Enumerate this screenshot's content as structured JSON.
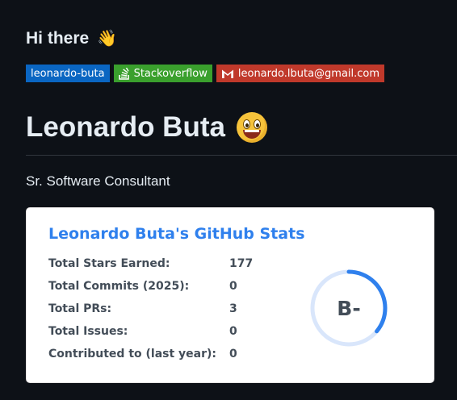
{
  "greeting": {
    "text": "Hi there",
    "emoji": "👋"
  },
  "badges": [
    {
      "label": "leonardo-buta",
      "color": "#0a66c2",
      "icon": "none"
    },
    {
      "label": "Stackoverflow",
      "color": "#3aa02d",
      "icon": "stackoverflow-icon"
    },
    {
      "label": "leonardo.lbuta@gmail.com",
      "color": "#c0392b",
      "icon": "gmail-icon"
    }
  ],
  "profile": {
    "name": "Leonardo Buta",
    "emoji": "grinning-face",
    "subtitle": "Sr. Software Consultant"
  },
  "stats_card": {
    "title": "Leonardo Buta's GitHub Stats",
    "rows": [
      {
        "label": "Total Stars Earned:",
        "value": "177"
      },
      {
        "label": "Total Commits (2025):",
        "value": "0"
      },
      {
        "label": "Total PRs:",
        "value": "3"
      },
      {
        "label": "Total Issues:",
        "value": "0"
      },
      {
        "label": "Contributed to (last year):",
        "value": "0"
      }
    ],
    "rank": {
      "grade": "B-",
      "progress": 0.36,
      "ring_color": "#2f80ed",
      "track_color": "#d9e6fb"
    }
  }
}
